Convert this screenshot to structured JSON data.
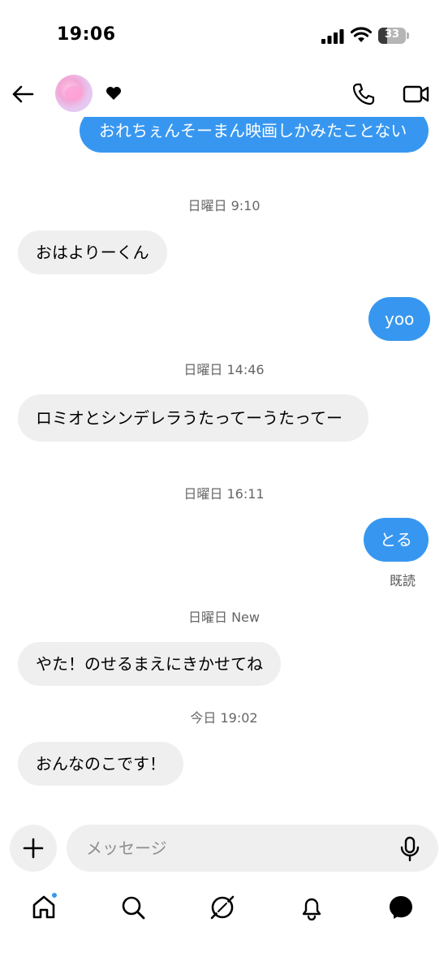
{
  "status_bar": {
    "time": "19:06",
    "battery": "33"
  },
  "header": {
    "back_icon": "arrow-left-icon",
    "contact_icon": "heart-icon",
    "call_icon": "phone-icon",
    "video_icon": "video-camera-icon"
  },
  "messages": [
    {
      "type": "out",
      "text": "おれちぇんそーまん映画しかみたことない"
    },
    {
      "type": "time",
      "text": "日曜日 9:10"
    },
    {
      "type": "in",
      "text": "おはよりーくん"
    },
    {
      "type": "out",
      "text": "yoo"
    },
    {
      "type": "time",
      "text": "日曜日 14:46"
    },
    {
      "type": "in",
      "text": "ロミオとシンデレラうたってーうたってー"
    },
    {
      "type": "time",
      "text": "日曜日 16:11"
    },
    {
      "type": "out",
      "text": "とる"
    },
    {
      "type": "seen",
      "text": "既読"
    },
    {
      "type": "time",
      "text": "日曜日 New"
    },
    {
      "type": "in",
      "text": "やた！のせるまえにきかせてね"
    },
    {
      "type": "time",
      "text": "今日 19:02"
    },
    {
      "type": "in",
      "text": "おんなのこです！"
    }
  ],
  "composer": {
    "placeholder": "メッセージ",
    "plus_icon": "plus-icon",
    "mic_icon": "microphone-icon"
  },
  "nav": {
    "items": [
      "home-icon",
      "search-icon",
      "explore-icon",
      "bell-icon",
      "messenger-icon"
    ],
    "home_has_badge": true,
    "accent": "#3797f0"
  },
  "colors": {
    "outgoing_bubble": "#3797f0",
    "incoming_bubble": "#efefef"
  }
}
